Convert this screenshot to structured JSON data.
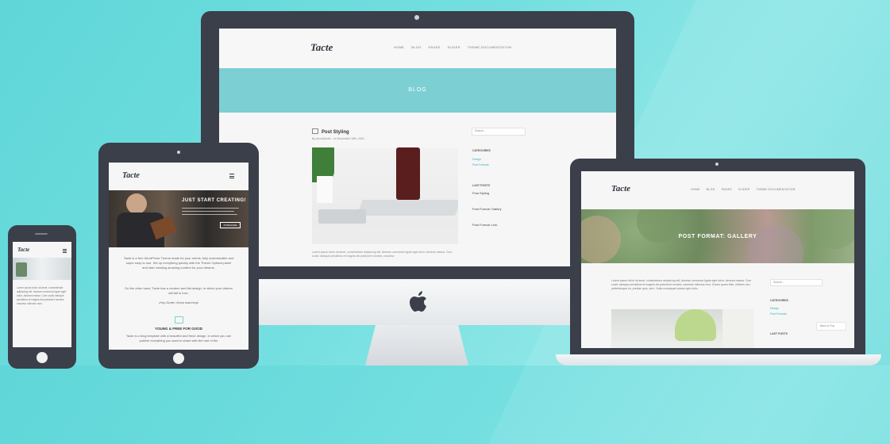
{
  "desktop": {
    "logo": "Tacte",
    "nav": [
      "HOME",
      "BLOG",
      "PAGES",
      "SLIDER",
      "THEME DOCUMENTATION"
    ],
    "hero_title": "BLOG",
    "post_title": "Post Styling",
    "post_meta": "By ArrowStudio · on November 18th, 2016",
    "search_placeholder": "Search...",
    "categories_title": "CATEGORIES",
    "categories": [
      "Design",
      "Post Formats"
    ],
    "last_posts_title": "LAST POSTS",
    "last_posts": [
      "Post Styling",
      "Post Format: Gallery",
      "Post Format: Link"
    ],
    "excerpt": "Lorem ipsum dolor sit amet, consectetuer adipiscing elit. Aenean commodo ligula eget dolor. Aenean massa. Cum sociis natoque penatibus et magnis dis parturient montes, nascetur"
  },
  "tablet": {
    "logo": "Tacte",
    "menu_icon": "hamburger-icon",
    "hero_title": "JUST START CREATING!",
    "hero_button": "PURCHASE",
    "intro": "Tacte is a free WordPress Theme made for your needs, fully customizable and super easy to use. Set up everything quickly with the Theme Options panel and start creating amazing content for your dreams.",
    "intro2": "On the other hand, Tacte has a modern and flat design, in which your visitors will fall in love.",
    "tagline": "¡Hey Dude! ¡Keep watching!",
    "section_title": "YOUNG & FREE FOR GOOD",
    "section_text": "Tacte is a blog template with a beautiful and fresh design, in which you can publish everything you want to share with the rest of the"
  },
  "laptop": {
    "logo": "Tacte",
    "nav": [
      "HOME",
      "BLOG",
      "PAGES",
      "SLIDER",
      "THEME DOCUMENTATION"
    ],
    "hero_title": "POST FORMAT: GALLERY",
    "excerpt": "Lorem ipsum dolor sit amet, consectetuer adipiscing elit. Aenean commodo ligula eget dolor. Aenean massa. Cum sociis natoque penatibus et magnis dis parturient montes, nascetur ridiculus mus. Donec quam felis, ultricies nec, pellentesque eu, pretium quis, sem. Nulla consequat massa quis enim.",
    "search_placeholder": "Search...",
    "categories_title": "CATEGORIES",
    "categories": [
      "Design",
      "Post Formats"
    ],
    "last_posts_title": "LAST POSTS",
    "back_to_top": "Back to Top"
  },
  "phone": {
    "logo": "Tacte",
    "text": "Lorem ipsum dolor sit amet, consectetuer adipiscing elit. Aenean commodo ligula eget dolor. Aenean massa. Cum sociis natoque penatibus et magnis dis parturient montes, nascetur ridiculus mus."
  },
  "colors": {
    "background": "#6fdcdd",
    "device": "#3a3f4a",
    "accent": "#7ccfd3"
  }
}
